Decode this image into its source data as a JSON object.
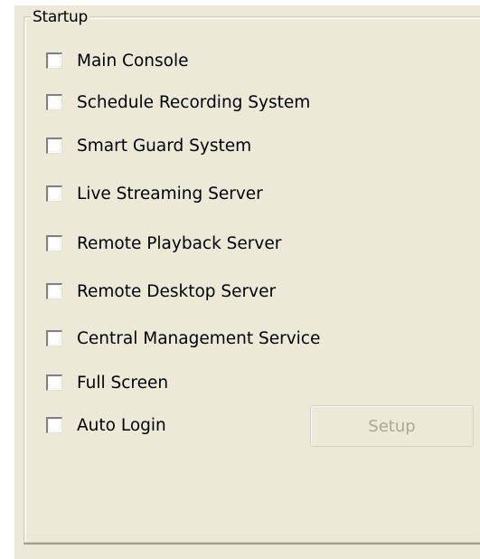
{
  "group": {
    "title": "Startup"
  },
  "options": [
    {
      "label": "Main Console",
      "checked": false
    },
    {
      "label": "Schedule Recording System",
      "checked": false
    },
    {
      "label": "Smart Guard System",
      "checked": false
    },
    {
      "label": "Live Streaming Server",
      "checked": false
    },
    {
      "label": "Remote Playback Server",
      "checked": false
    },
    {
      "label": "Remote Desktop Server",
      "checked": false
    },
    {
      "label": "Central Management Service",
      "checked": false
    },
    {
      "label": "Full Screen",
      "checked": false
    },
    {
      "label": "Auto Login",
      "checked": false
    }
  ],
  "setup_button": {
    "label": "Setup",
    "enabled": false
  }
}
